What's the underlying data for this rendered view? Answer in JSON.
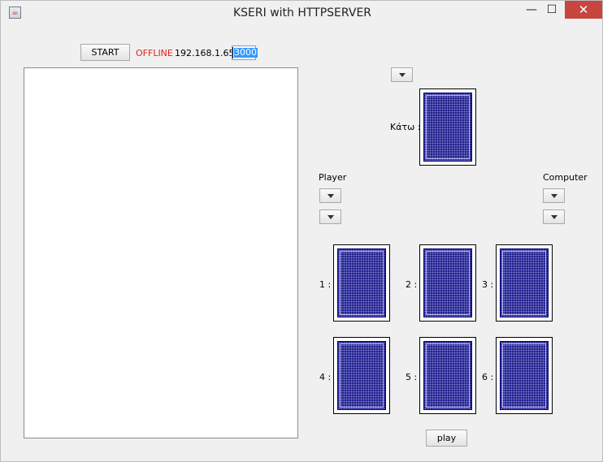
{
  "window": {
    "title": "KSERI with HTTPSERVER",
    "close_glyph": "✕",
    "min_glyph": "—",
    "max_glyph": "☐"
  },
  "toolbar": {
    "start_label": "START",
    "status": "OFFLINE",
    "ip": "192.168.1.65",
    "port": "3000"
  },
  "table": {
    "down_label": "Κάτω :"
  },
  "player": {
    "label": "Player"
  },
  "computer": {
    "label": "Computer"
  },
  "hand": [
    {
      "label": "1 :"
    },
    {
      "label": "2 :"
    },
    {
      "label": "3 :"
    },
    {
      "label": "4 :"
    },
    {
      "label": "5 :"
    },
    {
      "label": "6 :"
    }
  ],
  "actions": {
    "play_label": "play"
  },
  "colors": {
    "status": "#e0201b",
    "card_back": "#1f1f8a",
    "close_button": "#c7463f"
  }
}
